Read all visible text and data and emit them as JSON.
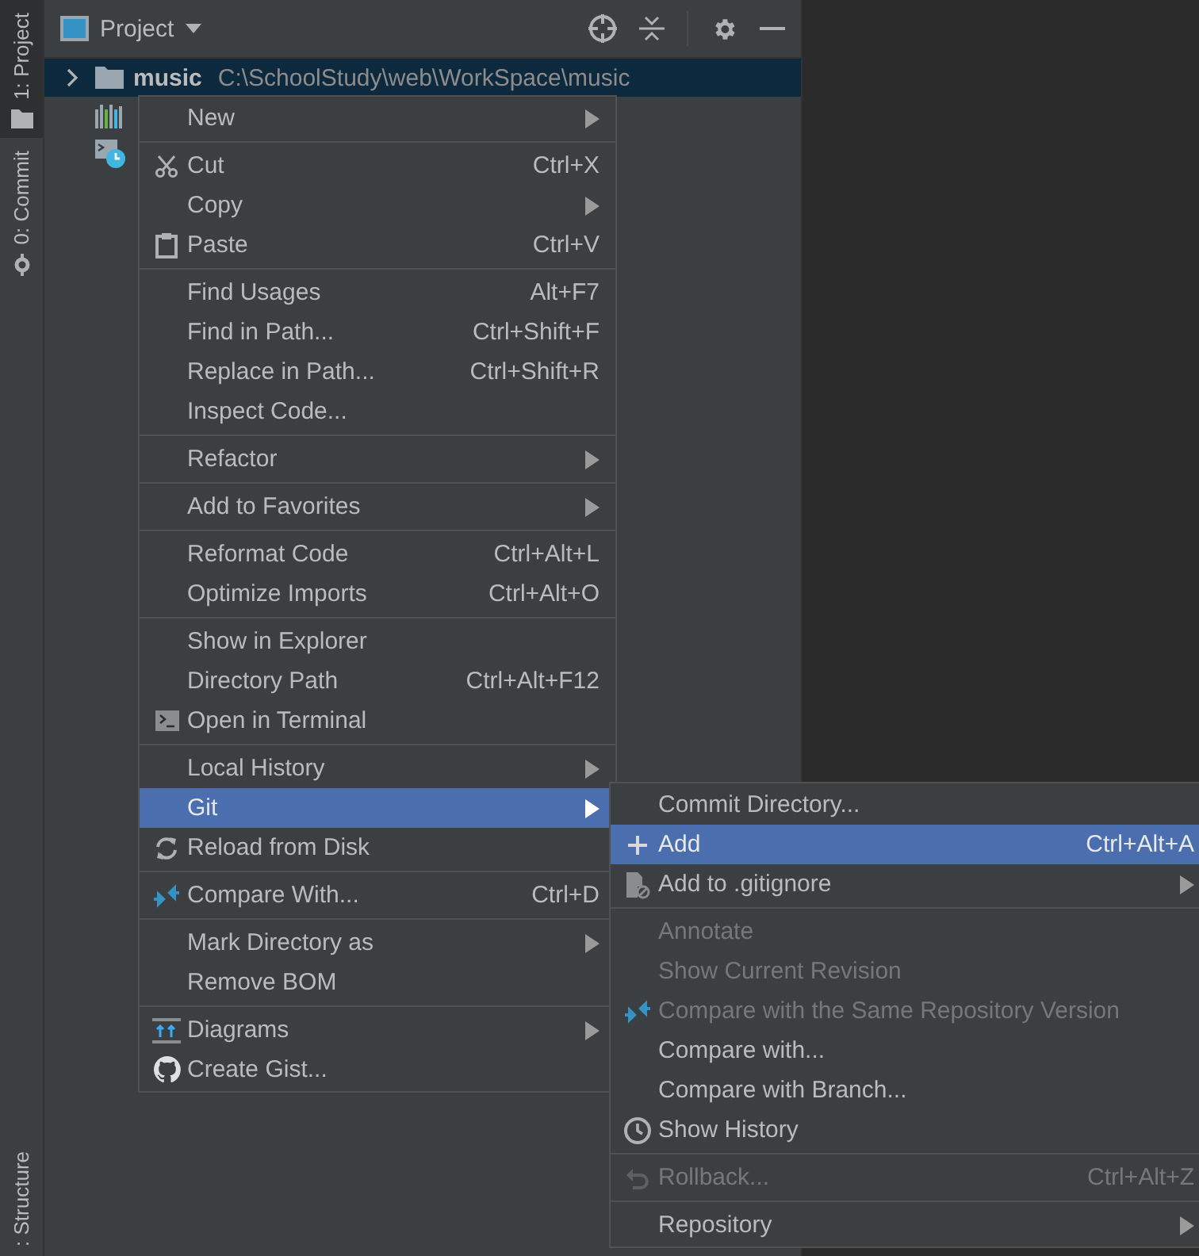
{
  "tool_tabs": [
    {
      "label": "1: Project",
      "selected": true
    },
    {
      "label": "0: Commit",
      "selected": false
    },
    {
      "label": ": Structure",
      "selected": false
    }
  ],
  "panel": {
    "title": "Project"
  },
  "tree": [
    {
      "name": "music",
      "path": "C:\\SchoolStudy\\web\\WorkSpace\\music",
      "selected": true,
      "expanded": false
    },
    {
      "selected": false
    },
    {
      "selected": false
    }
  ],
  "context_menu": [
    {
      "kind": "item",
      "label": "New",
      "submenu": true,
      "selected": false,
      "disabled": false
    },
    {
      "kind": "separator"
    },
    {
      "kind": "item",
      "label": "Cut",
      "shortcut": "Ctrl+X",
      "selected": false,
      "disabled": false
    },
    {
      "kind": "item",
      "label": "Copy",
      "submenu": true,
      "selected": false,
      "disabled": false
    },
    {
      "kind": "item",
      "label": "Paste",
      "shortcut": "Ctrl+V",
      "selected": false,
      "disabled": false
    },
    {
      "kind": "separator"
    },
    {
      "kind": "item",
      "label": "Find Usages",
      "shortcut": "Alt+F7",
      "selected": false,
      "disabled": false
    },
    {
      "kind": "item",
      "label": "Find in Path...",
      "shortcut": "Ctrl+Shift+F",
      "selected": false,
      "disabled": false
    },
    {
      "kind": "item",
      "label": "Replace in Path...",
      "shortcut": "Ctrl+Shift+R",
      "selected": false,
      "disabled": false
    },
    {
      "kind": "item",
      "label": "Inspect Code...",
      "selected": false,
      "disabled": false
    },
    {
      "kind": "separator"
    },
    {
      "kind": "item",
      "label": "Refactor",
      "submenu": true,
      "selected": false,
      "disabled": false
    },
    {
      "kind": "separator"
    },
    {
      "kind": "item",
      "label": "Add to Favorites",
      "submenu": true,
      "selected": false,
      "disabled": false
    },
    {
      "kind": "separator"
    },
    {
      "kind": "item",
      "label": "Reformat Code",
      "shortcut": "Ctrl+Alt+L",
      "selected": false,
      "disabled": false
    },
    {
      "kind": "item",
      "label": "Optimize Imports",
      "shortcut": "Ctrl+Alt+O",
      "selected": false,
      "disabled": false
    },
    {
      "kind": "separator"
    },
    {
      "kind": "item",
      "label": "Show in Explorer",
      "selected": false,
      "disabled": false
    },
    {
      "kind": "item",
      "label": "Directory Path",
      "shortcut": "Ctrl+Alt+F12",
      "selected": false,
      "disabled": false
    },
    {
      "kind": "item",
      "label": "Open in Terminal",
      "selected": false,
      "disabled": false
    },
    {
      "kind": "separator"
    },
    {
      "kind": "item",
      "label": "Local History",
      "submenu": true,
      "selected": false,
      "disabled": false
    },
    {
      "kind": "item",
      "label": "Git",
      "submenu": true,
      "selected": true,
      "disabled": false
    },
    {
      "kind": "item",
      "label": "Reload from Disk",
      "selected": false,
      "disabled": false
    },
    {
      "kind": "separator"
    },
    {
      "kind": "item",
      "label": "Compare With...",
      "shortcut": "Ctrl+D",
      "selected": false,
      "disabled": false
    },
    {
      "kind": "separator"
    },
    {
      "kind": "item",
      "label": "Mark Directory as",
      "submenu": true,
      "selected": false,
      "disabled": false
    },
    {
      "kind": "item",
      "label": "Remove BOM",
      "selected": false,
      "disabled": false
    },
    {
      "kind": "separator"
    },
    {
      "kind": "item",
      "label": "Diagrams",
      "submenu": true,
      "selected": false,
      "disabled": false
    },
    {
      "kind": "item",
      "label": "Create Gist...",
      "selected": false,
      "disabled": false
    }
  ],
  "git_submenu": [
    {
      "kind": "item",
      "label": "Commit Directory...",
      "selected": false,
      "disabled": false
    },
    {
      "kind": "item",
      "label": "Add",
      "shortcut": "Ctrl+Alt+A",
      "selected": true,
      "disabled": false
    },
    {
      "kind": "item",
      "label": "Add to .gitignore",
      "submenu": true,
      "selected": false,
      "disabled": false
    },
    {
      "kind": "separator"
    },
    {
      "kind": "item",
      "label": "Annotate",
      "selected": false,
      "disabled": true
    },
    {
      "kind": "item",
      "label": "Show Current Revision",
      "selected": false,
      "disabled": true
    },
    {
      "kind": "item",
      "label": "Compare with the Same Repository Version",
      "selected": false,
      "disabled": true
    },
    {
      "kind": "item",
      "label": "Compare with...",
      "selected": false,
      "disabled": false
    },
    {
      "kind": "item",
      "label": "Compare with Branch...",
      "selected": false,
      "disabled": false
    },
    {
      "kind": "item",
      "label": "Show History",
      "selected": false,
      "disabled": false
    },
    {
      "kind": "separator"
    },
    {
      "kind": "item",
      "label": "Rollback...",
      "shortcut": "Ctrl+Alt+Z",
      "selected": false,
      "disabled": true
    },
    {
      "kind": "separator"
    },
    {
      "kind": "item",
      "label": "Repository",
      "submenu": true,
      "selected": false,
      "disabled": false
    }
  ]
}
